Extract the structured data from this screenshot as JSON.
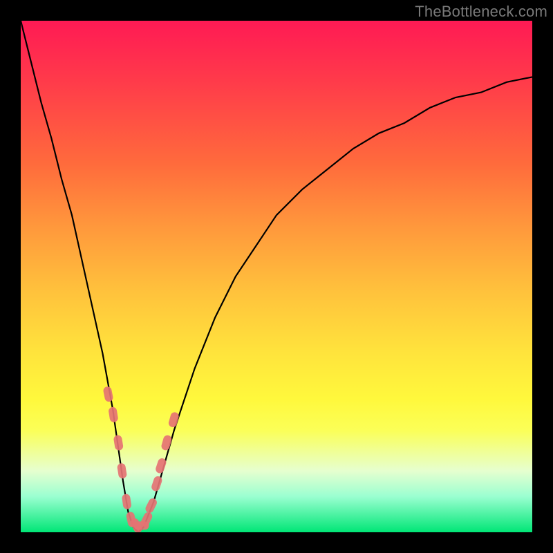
{
  "watermark": "TheBottleneck.com",
  "colors": {
    "frame": "#000000",
    "pill": "#e57373",
    "curve": "#000000",
    "gradient_top": "#ff1a54",
    "gradient_bottom": "#00e676"
  },
  "chart_data": {
    "type": "line",
    "title": "",
    "xlabel": "",
    "ylabel": "",
    "xlim": [
      0,
      100
    ],
    "ylim": [
      0,
      100
    ],
    "grid": false,
    "annotations": [
      "TheBottleneck.com"
    ],
    "x": [
      0,
      2,
      4,
      6,
      8,
      10,
      12,
      14,
      16,
      18,
      20,
      21,
      22,
      23,
      24,
      26,
      28,
      30,
      34,
      38,
      42,
      46,
      50,
      55,
      60,
      65,
      70,
      75,
      80,
      85,
      90,
      95,
      100
    ],
    "y": [
      100,
      92,
      84,
      77,
      69,
      62,
      53,
      44,
      35,
      24,
      10,
      4,
      1,
      0,
      1,
      6,
      13,
      20,
      32,
      42,
      50,
      56,
      62,
      67,
      71,
      75,
      78,
      80,
      83,
      85,
      86,
      88,
      89
    ],
    "legend": null,
    "markers": {
      "note": "Highlighted pill-shaped markers near the curve minimum",
      "points": [
        {
          "x": 17.1,
          "y": 27.0
        },
        {
          "x": 18.1,
          "y": 23.0
        },
        {
          "x": 19.1,
          "y": 17.5
        },
        {
          "x": 19.8,
          "y": 12.0
        },
        {
          "x": 20.7,
          "y": 6.0
        },
        {
          "x": 21.6,
          "y": 2.5
        },
        {
          "x": 22.6,
          "y": 1.3
        },
        {
          "x": 23.6,
          "y": 1.3
        },
        {
          "x": 24.6,
          "y": 2.5
        },
        {
          "x": 25.5,
          "y": 5.2
        },
        {
          "x": 26.6,
          "y": 9.5
        },
        {
          "x": 27.4,
          "y": 13.0
        },
        {
          "x": 28.5,
          "y": 17.5
        },
        {
          "x": 29.9,
          "y": 22.0
        }
      ]
    }
  }
}
